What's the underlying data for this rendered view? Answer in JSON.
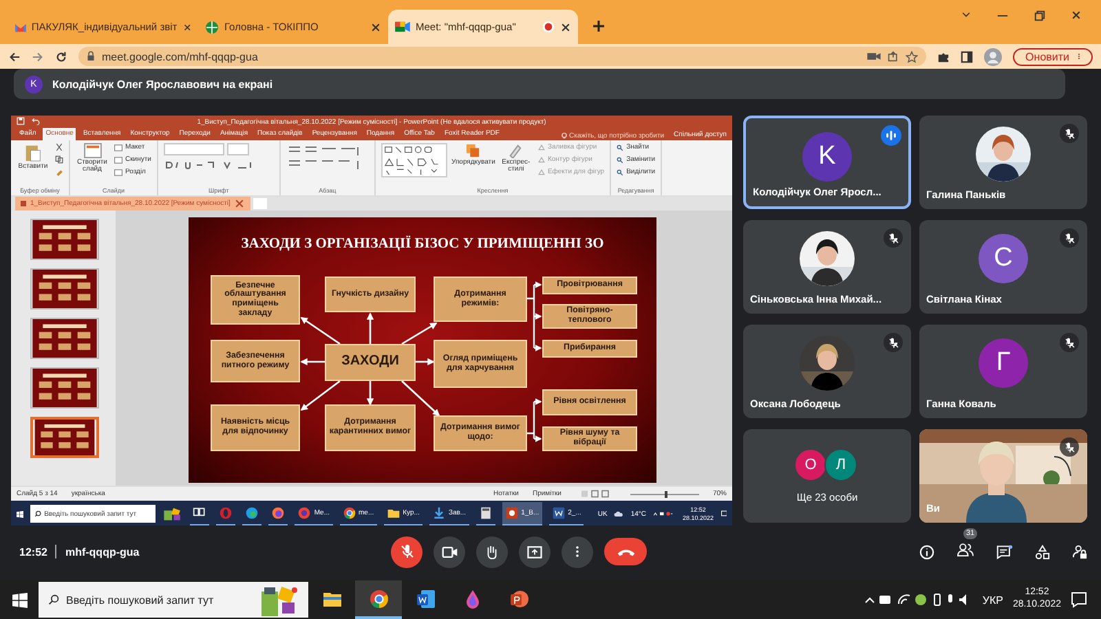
{
  "browser": {
    "tabs": [
      {
        "title": "ПАКУЛЯК_індивідуальний звіт",
        "kind": "mail",
        "selected": false,
        "recording": false
      },
      {
        "title": "Головна - ТОКІППО",
        "kind": "globe",
        "selected": false,
        "recording": false
      },
      {
        "title": "Meet: \"mhf-qqqp-gua\"",
        "kind": "meet",
        "selected": true,
        "recording": true
      }
    ],
    "url": "meet.google.com/mhf-qqqp-gua",
    "update_button": "Оновити"
  },
  "meet": {
    "presenter_banner": {
      "initial": "K",
      "text": "Колодійчук Олег Ярославович на екрані"
    },
    "shared_screen": {
      "powerpoint": {
        "title": "1_Виступ_Педагогічна вітальня_28.10.2022 [Режим сумісності] - PowerPoint (Не вдалося активувати продукт)",
        "tabs": [
          {
            "label": "Файл",
            "selected": false
          },
          {
            "label": "Основне",
            "selected": true
          },
          {
            "label": "Вставлення",
            "selected": false
          },
          {
            "label": "Конструктор",
            "selected": false
          },
          {
            "label": "Переходи",
            "selected": false
          },
          {
            "label": "Анімація",
            "selected": false
          },
          {
            "label": "Показ слайдів",
            "selected": false
          },
          {
            "label": "Рецензування",
            "selected": false
          },
          {
            "label": "Подання",
            "selected": false
          },
          {
            "label": "Office Tab",
            "selected": false
          },
          {
            "label": "Foxit Reader PDF",
            "selected": false
          }
        ],
        "tell_me": "Скажіть, що потрібно зробити",
        "share": "Спільний доступ",
        "ribbon_groups": [
          {
            "kind": "clipboard",
            "label": "Буфер обміну",
            "buttons": [
              "Вставити"
            ]
          },
          {
            "kind": "slides",
            "label": "Слайди",
            "buttons": [
              "Створити слайд",
              "Макет",
              "Скинути",
              "Розділ"
            ]
          },
          {
            "kind": "font",
            "label": "Шрифт"
          },
          {
            "kind": "paragraph",
            "label": "Абзац"
          },
          {
            "kind": "drawing",
            "label": "Креслення",
            "buttons": [
              "Упорядкувати",
              "Експрес-стилі",
              "Заливка фігури",
              "Контур фігури",
              "Ефекти для фігур"
            ]
          },
          {
            "kind": "editing",
            "label": "Редагування",
            "buttons": [
              "Знайти",
              "Замінити",
              "Виділити"
            ]
          }
        ],
        "document_tab": "1_Виступ_Педагогічна вітальня_28.10.2022 [Режим сумісності]",
        "slide_thumbnails": [
          {
            "selected": false
          },
          {
            "selected": false
          },
          {
            "selected": false
          },
          {
            "selected": false
          },
          {
            "selected": true
          }
        ],
        "slide": {
          "title": "ЗАХОДИ З ОРГАНІЗАЦІЇ БІЗОС У ПРИМІЩЕННІ ЗО",
          "nodes": [
            {
              "kind": "box",
              "text": "Безпечне облаштування приміщень закладу"
            },
            {
              "kind": "box",
              "text": "Гнучкість дизайну"
            },
            {
              "kind": "box",
              "text": "Дотримання режимів:"
            },
            {
              "kind": "sub",
              "text": "Провітрювання"
            },
            {
              "kind": "sub",
              "text": "Повітряно-теплового"
            },
            {
              "kind": "sub",
              "text": "Прибирання"
            },
            {
              "kind": "box",
              "text": "Забезпечення питного режиму"
            },
            {
              "kind": "center",
              "text": "ЗАХОДИ"
            },
            {
              "kind": "box",
              "text": "Огляд приміщень для харчування"
            },
            {
              "kind": "sub",
              "text": "Рівня освітлення"
            },
            {
              "kind": "sub",
              "text": "Рівня шуму та вібрації"
            },
            {
              "kind": "box",
              "text": "Наявність місць для відпочинку"
            },
            {
              "kind": "box",
              "text": "Дотримання карантинних вимог"
            },
            {
              "kind": "box",
              "text": "Дотримання вимог щодо:"
            }
          ]
        },
        "status_bar": {
          "slide_counter": "Слайд 5 з 14",
          "language": "українська",
          "notes": "Нотатки",
          "comments": "Примітки",
          "zoom": "70%",
          "zoom_slider": {
            "level": 0.5
          }
        }
      },
      "taskbar": {
        "search_placeholder": "Введіть пошуковий запит тут",
        "apps": [
          {
            "kind": "taskview",
            "active": false
          },
          {
            "kind": "opera",
            "active": false
          },
          {
            "kind": "edge",
            "active": false
          },
          {
            "kind": "firefox",
            "active": false
          },
          {
            "kind": "meet",
            "label": "Ме...",
            "active": false
          },
          {
            "kind": "chrome",
            "label": "me...",
            "active": false
          },
          {
            "kind": "folder",
            "label": "Кур...",
            "active": false
          },
          {
            "kind": "download",
            "label": "Зав...",
            "active": false
          },
          {
            "kind": "calculator",
            "active": false
          },
          {
            "kind": "powerpoint",
            "label": "1_В...",
            "active": true
          },
          {
            "kind": "word",
            "label": "2_...",
            "active": false
          }
        ],
        "language": "UK",
        "weather": "14°C",
        "time": "12:52",
        "date": "28.10.2022"
      }
    },
    "participants": [
      {
        "kind": "initial",
        "name": "Колодійчук Олег Яросл...",
        "initial": "K",
        "color": "#5e35b1",
        "muted": false,
        "speaking": true
      },
      {
        "name": "Галина Паньків",
        "muted": true,
        "speaking": false
      },
      {
        "name": "Сіньковська Інна Михай...",
        "muted": true,
        "speaking": false
      },
      {
        "kind": "initial",
        "name": "Світлана Кінах",
        "initial": "С",
        "color": "#7e57c2",
        "muted": true,
        "speaking": false
      },
      {
        "name": "Оксана Лободець",
        "muted": true,
        "speaking": false
      },
      {
        "kind": "initial",
        "name": "Ганна Коваль",
        "initial": "Г",
        "color": "#8e24aa",
        "muted": true,
        "speaking": false
      },
      {
        "kind": "others",
        "text": "Ще 23 особи",
        "avatars": [
          {
            "initial": "О",
            "color": "#d81b60"
          },
          {
            "initial": "Л",
            "color": "#00897b"
          }
        ]
      },
      {
        "kind": "self",
        "name": "Ви",
        "muted": true,
        "speaking": false
      }
    ],
    "bottom_bar": {
      "time": "12:52",
      "meeting_code": "mhf-qqqp-gua",
      "mic_muted": true,
      "people_count": "31"
    }
  },
  "taskbar": {
    "search_placeholder": "Введіть пошуковий запит тут",
    "apps": [
      {
        "kind": "explorer",
        "active": false
      },
      {
        "kind": "chrome",
        "active": true
      },
      {
        "kind": "word",
        "active": false
      },
      {
        "kind": "drop",
        "active": false
      },
      {
        "kind": "powerpoint",
        "active": false
      }
    ],
    "language": "УКР",
    "time": "12:52",
    "date": "28.10.2022"
  }
}
